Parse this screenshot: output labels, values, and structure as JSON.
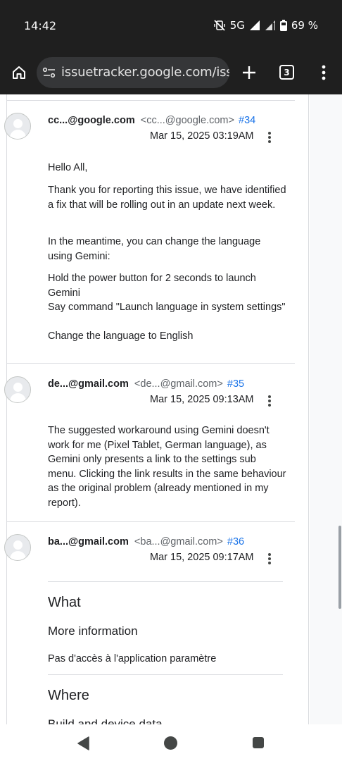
{
  "status_bar": {
    "time": "14:42",
    "network": "5G",
    "battery": "69 %",
    "icons": [
      "mute-vibrate-icon",
      "signal-icon",
      "signal-icon",
      "battery-icon"
    ]
  },
  "toolbar": {
    "url": "issuetracker.google.com/issue",
    "tab_count": "3",
    "icons": [
      "home-icon",
      "site-settings-icon",
      "new-tab-plus-icon",
      "tabs-icon",
      "more-vert-icon"
    ]
  },
  "comments": [
    {
      "author": "cc...@google.com",
      "email": "<cc...@google.com>",
      "number": "#34",
      "date": "Mar 15, 2025 03:19AM",
      "paragraphs": [
        "Hello All,",
        "Thank you for reporting this issue, we have identified a fix that will be rolling out in an update next week.",
        "In the meantime, you can change the language using Gemini:",
        "Hold the power button for 2 seconds to launch Gemini",
        "Say command \"Launch language in system settings\"",
        "Change the language to English"
      ]
    },
    {
      "author": "de...@gmail.com",
      "email": "<de...@gmail.com>",
      "number": "#35",
      "date": "Mar 15, 2025 09:13AM",
      "paragraphs": [
        "The suggested workaround using Gemini doesn't work for me (Pixel Tablet, German language), as Gemini only presents a link to the settings sub menu. Clicking the link results in the same behaviour as the original problem (already mentioned in my report)."
      ]
    },
    {
      "author": "ba...@gmail.com",
      "email": "<ba...@gmail.com>",
      "number": "#36",
      "date": "Mar 15, 2025 09:17AM",
      "section_what": "What",
      "more_info_heading": "More information",
      "more_info_text": "Pas d'accès à l'application paramètre",
      "section_where": "Where",
      "build_heading": "Build and device data"
    }
  ],
  "nav_bar": {
    "icons": [
      "back-icon",
      "home-icon",
      "recents-icon"
    ]
  }
}
